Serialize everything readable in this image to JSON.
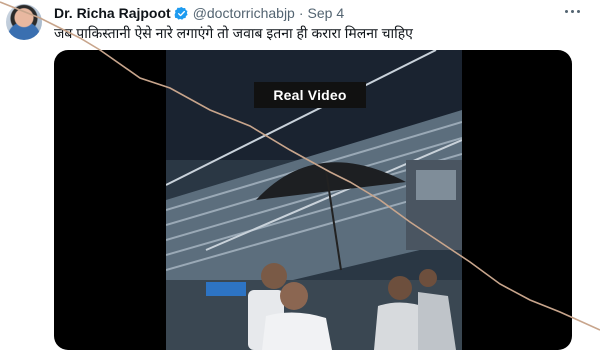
{
  "tweet": {
    "display_name": "Dr. Richa Rajpoot",
    "handle": "@doctorrichabjp",
    "separator": "·",
    "date": "Sep 4",
    "text": "जब पाकिस्तानी ऐसे नारे लगाएंगे तो जवाब इतना ही करारा मिलना चाहिए",
    "verified": true,
    "more_icon": "more-options-icon"
  },
  "media": {
    "overlay_label": "Real Video",
    "background": "#000000"
  },
  "annotation": {
    "strike_color": "#c8a58c"
  },
  "colors": {
    "verified_blue": "#1d9bf0",
    "secondary_text": "#536471",
    "primary_text": "#0f1419"
  }
}
